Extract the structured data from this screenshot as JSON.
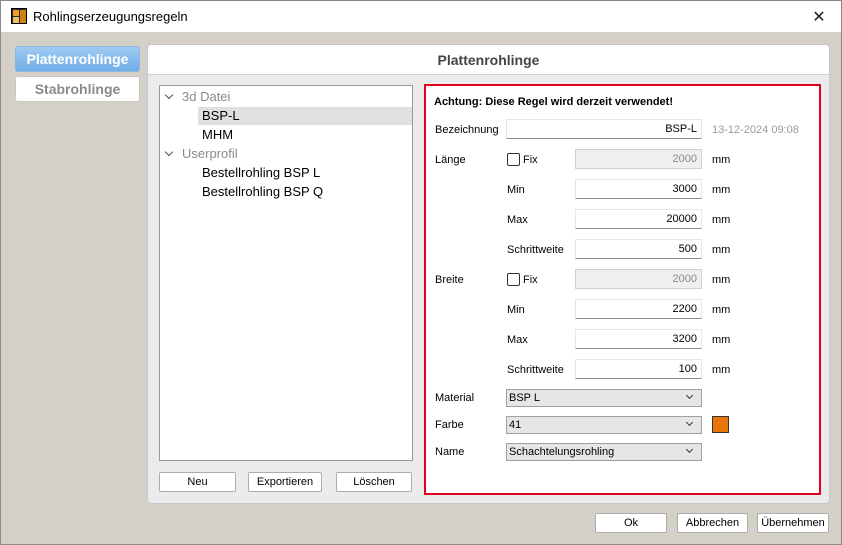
{
  "window": {
    "title": "Rohlingserzeugungsregeln"
  },
  "sidebar": {
    "tabs": [
      {
        "label": "Plattenrohlinge"
      },
      {
        "label": "Stabrohlinge"
      }
    ]
  },
  "panel": {
    "title": "Plattenrohlinge"
  },
  "tree": {
    "groups": [
      {
        "label": "3d Datei",
        "items": [
          {
            "label": "BSP-L"
          },
          {
            "label": "MHM"
          }
        ]
      },
      {
        "label": "Userprofil",
        "items": [
          {
            "label": "Bestellrohling BSP L"
          },
          {
            "label": "Bestellrohling BSP Q"
          }
        ]
      }
    ]
  },
  "list_buttons": {
    "new": "Neu",
    "export": "Exportieren",
    "delete": "Löschen"
  },
  "form": {
    "warning": "Achtung: Diese Regel wird derzeit verwendet!",
    "bezeichnung_label": "Bezeichnung",
    "bezeichnung_value": "BSP-L",
    "timestamp": "13-12-2024 09:08",
    "laenge": {
      "label": "Länge",
      "fix_label": "Fix",
      "fix_value": "2000",
      "min_label": "Min",
      "min_value": "3000",
      "max_label": "Max",
      "max_value": "20000",
      "step_label": "Schrittweite",
      "step_value": "500"
    },
    "breite": {
      "label": "Breite",
      "fix_label": "Fix",
      "fix_value": "2000",
      "min_label": "Min",
      "min_value": "2200",
      "max_label": "Max",
      "max_value": "3200",
      "step_label": "Schrittweite",
      "step_value": "100"
    },
    "unit": "mm",
    "material": {
      "label": "Material",
      "value": "BSP L"
    },
    "farbe": {
      "label": "Farbe",
      "value": "41",
      "swatch_color": "#e8750a"
    },
    "name": {
      "label": "Name",
      "value": "Schachtelungsrohling"
    }
  },
  "dialog_buttons": {
    "ok": "Ok",
    "cancel": "Abbrechen",
    "apply": "Übernehmen"
  },
  "colors": {
    "accent_tab": "#7cb8ee",
    "warning_border": "#e0001b"
  },
  "icons": {
    "close": "close-icon",
    "expand": "chevron-down-icon",
    "dropdown": "dropdown-caret-icon",
    "app": "app-icon"
  }
}
